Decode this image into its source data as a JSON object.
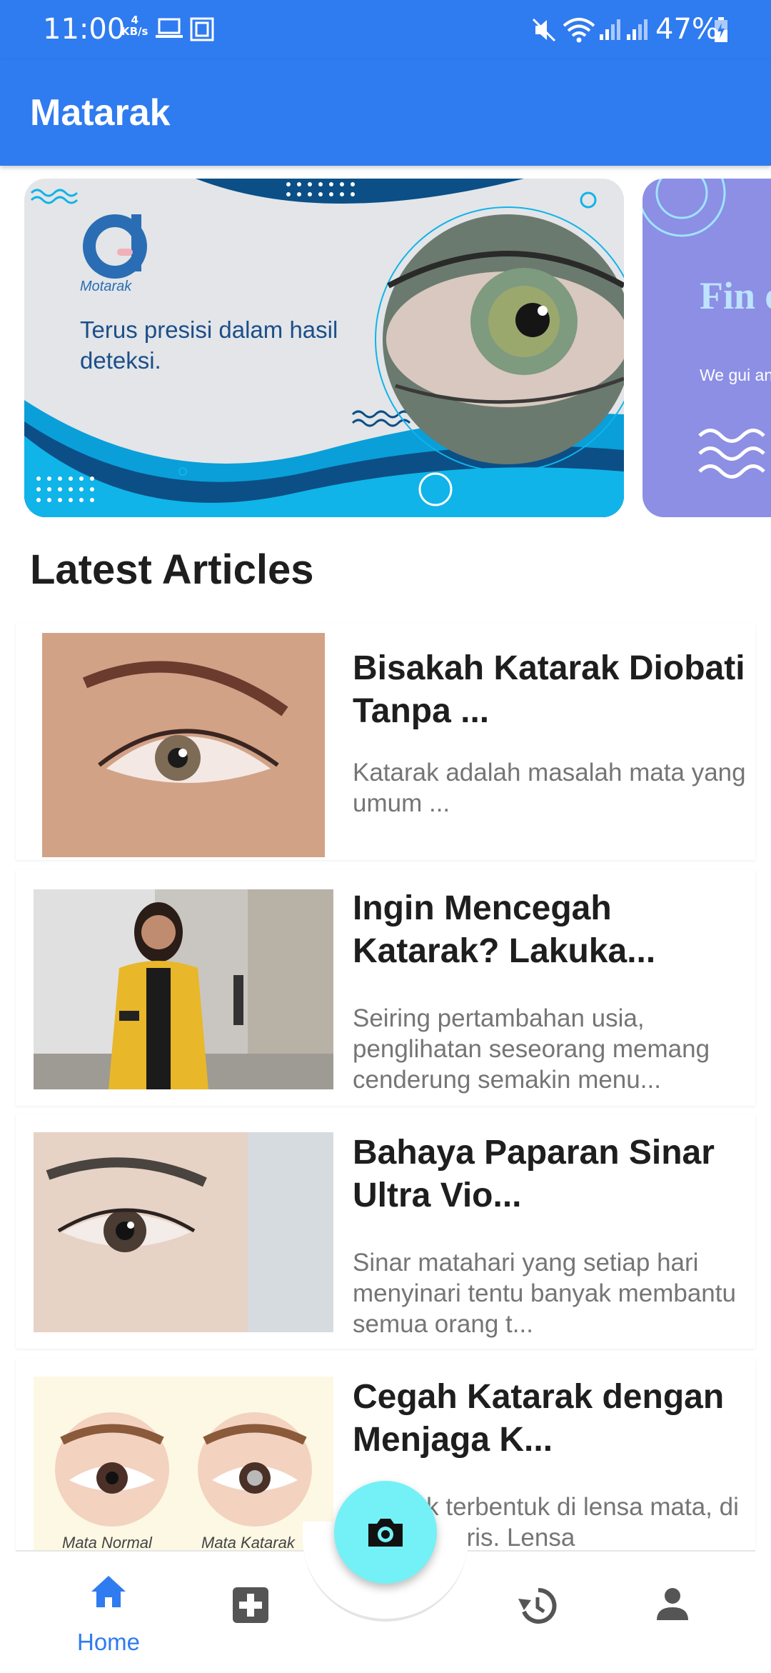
{
  "status_bar": {
    "time": "11:00",
    "net_speed_value": "4",
    "net_speed_unit": "KB/s",
    "battery": "47%"
  },
  "app_bar": {
    "title": "Matarak"
  },
  "carousel": {
    "banner1": {
      "logo_text": "Motarak",
      "tagline": "Terus presisi dalam hasil deteksi."
    },
    "banner2": {
      "title": "Fin eye",
      "text": "We gui and cre"
    }
  },
  "latest_articles": {
    "heading": "Latest Articles",
    "items": [
      {
        "title": "Bisakah Katarak Diobati Tanpa ...",
        "desc": "Katarak adalah masalah mata yang umum ..."
      },
      {
        "title": "Ingin Mencegah Katarak? Lakuka...",
        "desc": "Seiring pertambahan usia, penglihatan seseorang memang cenderung semakin menu..."
      },
      {
        "title": "Bahaya Paparan Sinar Ultra Vio...",
        "desc": "Sinar matahari yang setiap hari menyinari tentu banyak membantu semua orang t..."
      },
      {
        "title": "Cegah Katarak dengan Menjaga K...",
        "desc": "Katarak terbentuk di lensa mata, di belakang iris. Lensa",
        "thumb_label_left": "Mata Normal",
        "thumb_label_right": "Mata Katarak"
      }
    ]
  },
  "bottom_nav": {
    "home_label": "Home",
    "items": [
      "home-icon",
      "medical-plus-icon",
      "camera-icon",
      "history-icon",
      "person-icon"
    ]
  },
  "colors": {
    "primary": "#2f7bf0",
    "fab": "#74f1f6",
    "title_text": "#1e1e1e",
    "desc_text": "#757575"
  }
}
